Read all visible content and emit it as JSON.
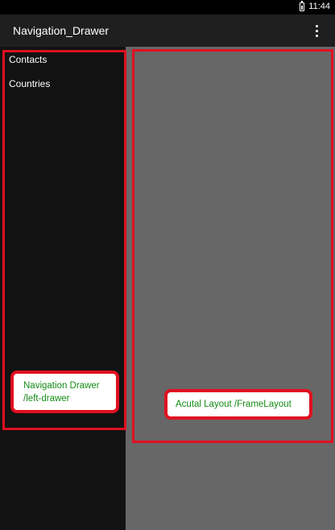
{
  "status_bar": {
    "time": "11:44",
    "battery_icon": "battery-icon"
  },
  "action_bar": {
    "title": "Navigation_Drawer",
    "overflow_icon": "overflow-menu-icon"
  },
  "drawer": {
    "items": [
      {
        "label": "Contacts"
      },
      {
        "label": "Countries"
      }
    ]
  },
  "annotations": {
    "drawer_callout": {
      "line1": "Navigation Drawer",
      "line2": "/left-drawer"
    },
    "frame_callout": {
      "text": "Acutal Layout /FrameLayout"
    },
    "highlight_color": "#e01020",
    "callout_text_color": "#158c15"
  },
  "colors": {
    "action_bar": "#1f1f1f",
    "drawer_bg": "#121212",
    "content_bg": "#676767"
  }
}
